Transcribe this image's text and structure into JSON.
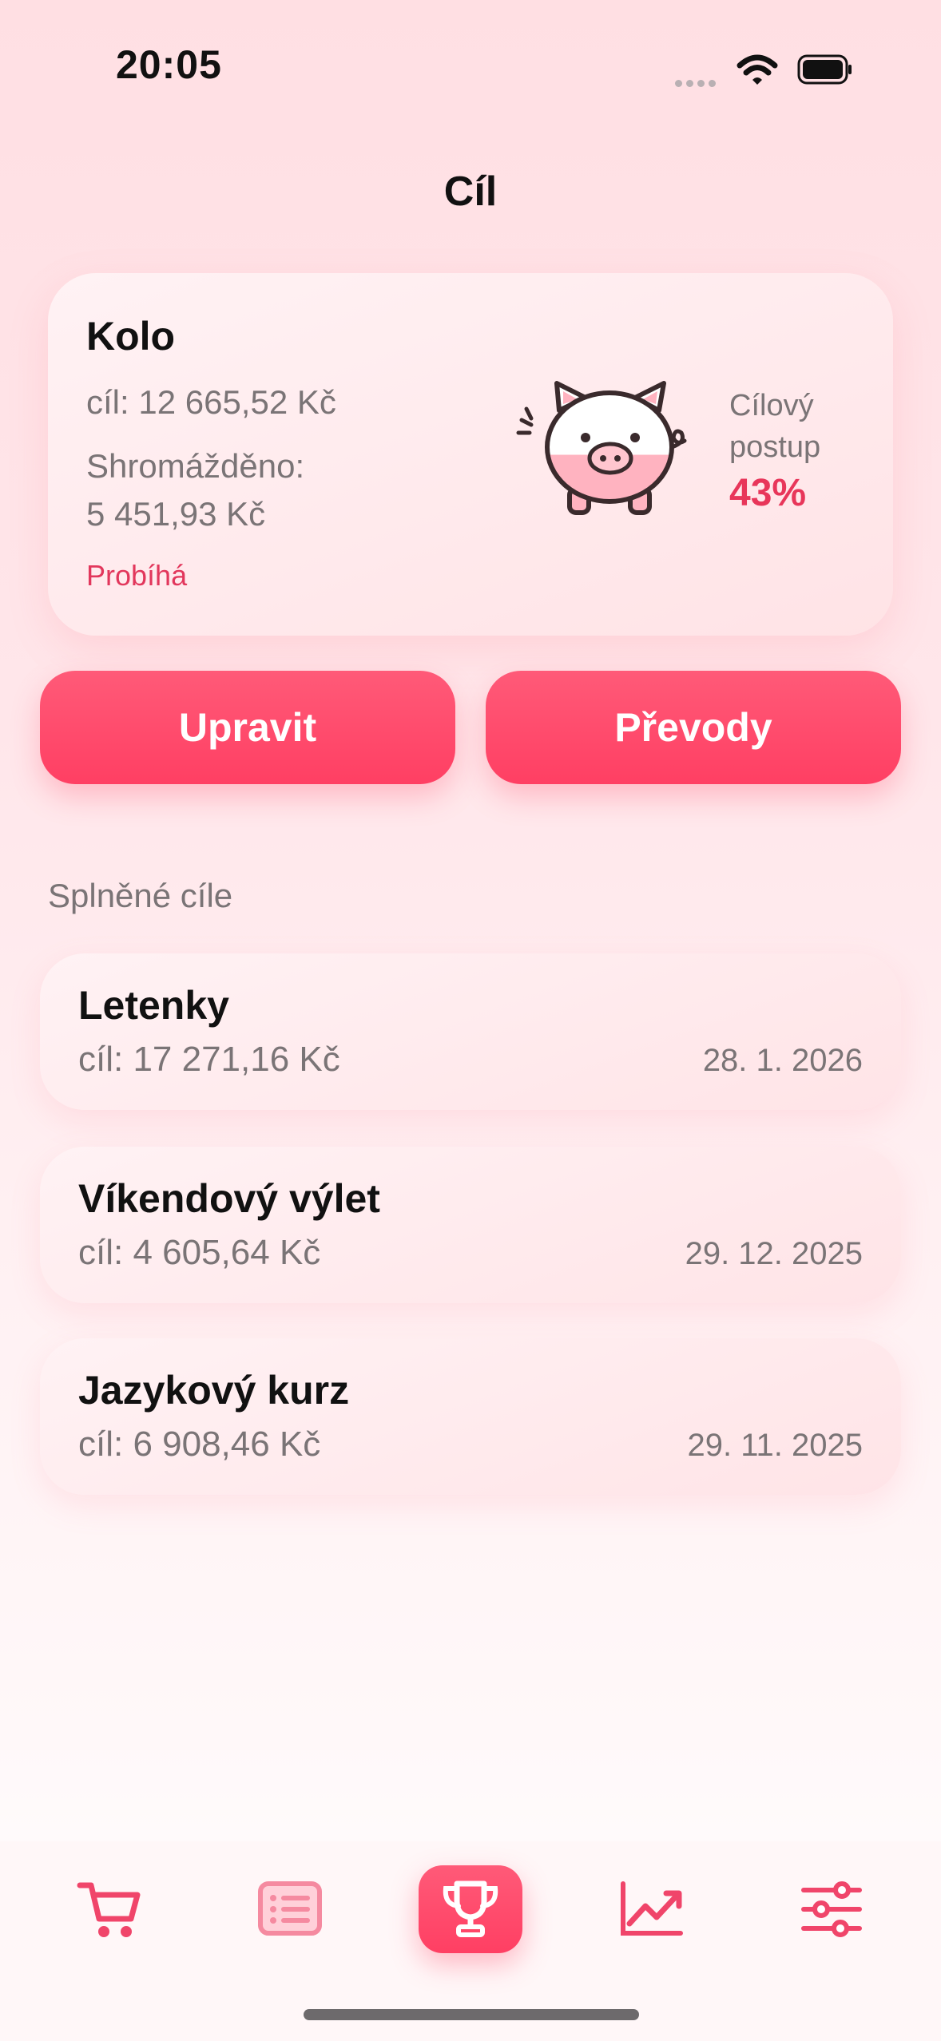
{
  "status_bar": {
    "time": "20:05"
  },
  "page": {
    "title": "Cíl"
  },
  "current_goal": {
    "name": "Kolo",
    "target": "cíl: 12 665,52 Kč",
    "collected_label": "Shromážděno:",
    "collected_value": "5 451,93 Kč",
    "status": "Probíhá",
    "progress_label": "Cílový postup",
    "progress_value": "43%",
    "progress_fraction": 0.43,
    "icon": "piggy-bank-icon"
  },
  "actions": {
    "edit_label": "Upravit",
    "transfers_label": "Převody"
  },
  "completed": {
    "section_title": "Splněné cíle",
    "items": [
      {
        "name": "Letenky",
        "target": "cíl: 17 271,16 Kč",
        "date": "28. 1. 2026"
      },
      {
        "name": "Víkendový výlet",
        "target": "cíl: 4 605,64 Kč",
        "date": "29. 12. 2025"
      },
      {
        "name": "Jazykový kurz",
        "target": "cíl: 6 908,46 Kč",
        "date": "29. 11. 2025"
      }
    ]
  },
  "tabbar": {
    "items": [
      "cart-icon",
      "list-icon",
      "trophy-icon",
      "chart-icon",
      "sliders-icon"
    ],
    "active_index": 2
  },
  "colors": {
    "accent": "#ff4466",
    "text_secondary": "#7a7476",
    "status": "#e2375c"
  }
}
